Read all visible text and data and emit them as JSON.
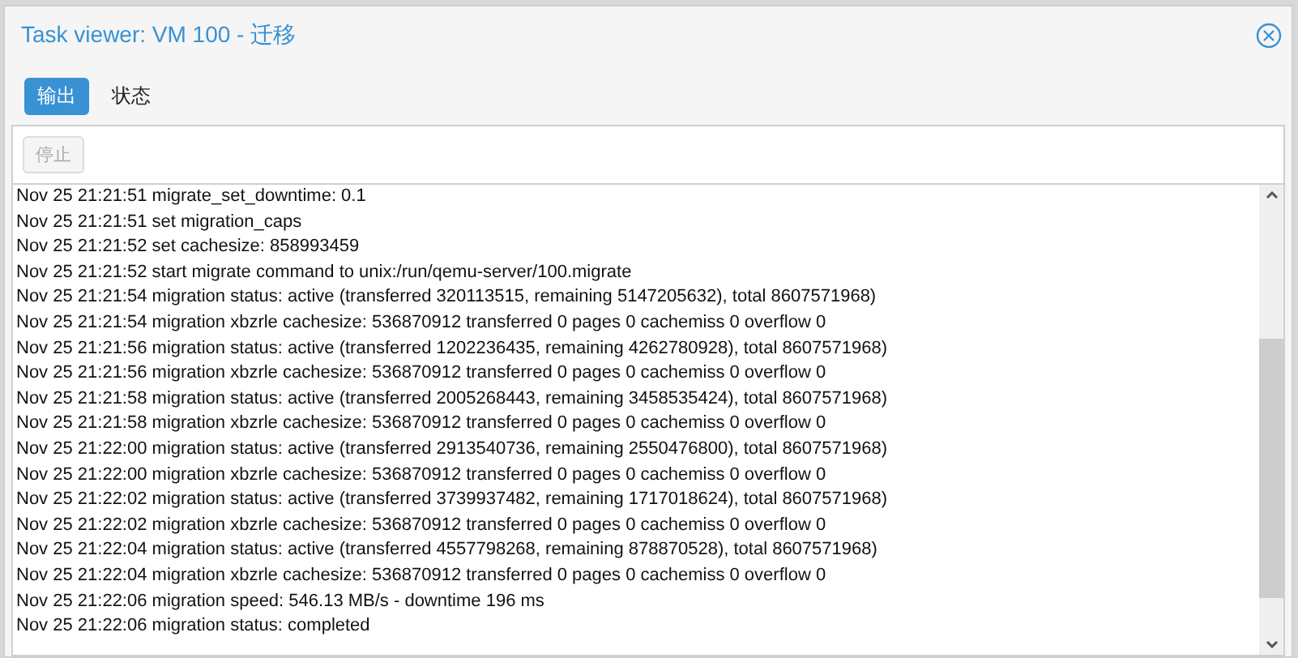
{
  "window": {
    "title": "Task viewer: VM 100 - 迁移"
  },
  "tabs": [
    {
      "label": "输出",
      "selected": true
    },
    {
      "label": "状态",
      "selected": false
    }
  ],
  "toolbar": {
    "stop_button": {
      "label": "停止",
      "disabled": true
    }
  },
  "log": [
    "Nov 25 21:21:51 migrate_set_downtime: 0.1",
    "Nov 25 21:21:51 set migration_caps",
    "Nov 25 21:21:52 set cachesize: 858993459",
    "Nov 25 21:21:52 start migrate command to unix:/run/qemu-server/100.migrate",
    "Nov 25 21:21:54 migration status: active (transferred 320113515, remaining 5147205632), total 8607571968)",
    "Nov 25 21:21:54 migration xbzrle cachesize: 536870912 transferred 0 pages 0 cachemiss 0 overflow 0",
    "Nov 25 21:21:56 migration status: active (transferred 1202236435, remaining 4262780928), total 8607571968)",
    "Nov 25 21:21:56 migration xbzrle cachesize: 536870912 transferred 0 pages 0 cachemiss 0 overflow 0",
    "Nov 25 21:21:58 migration status: active (transferred 2005268443, remaining 3458535424), total 8607571968)",
    "Nov 25 21:21:58 migration xbzrle cachesize: 536870912 transferred 0 pages 0 cachemiss 0 overflow 0",
    "Nov 25 21:22:00 migration status: active (transferred 2913540736, remaining 2550476800), total 8607571968)",
    "Nov 25 21:22:00 migration xbzrle cachesize: 536870912 transferred 0 pages 0 cachemiss 0 overflow 0",
    "Nov 25 21:22:02 migration status: active (transferred 3739937482, remaining 1717018624), total 8607571968)",
    "Nov 25 21:22:02 migration xbzrle cachesize: 536870912 transferred 0 pages 0 cachemiss 0 overflow 0",
    "Nov 25 21:22:04 migration status: active (transferred 4557798268, remaining 878870528), total 8607571968)",
    "Nov 25 21:22:04 migration xbzrle cachesize: 536870912 transferred 0 pages 0 cachemiss 0 overflow 0",
    "Nov 25 21:22:06 migration speed: 546.13 MB/s - downtime 196 ms",
    "Nov 25 21:22:06 migration status: completed"
  ]
}
